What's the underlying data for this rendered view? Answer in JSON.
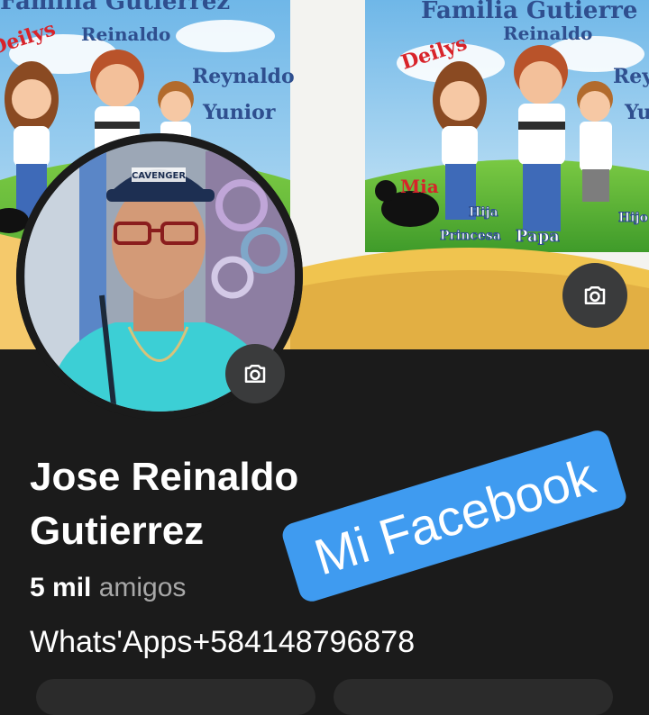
{
  "cover": {
    "title_left": "Familia Gutierrez",
    "title_right": "Familia Gutierre",
    "names": {
      "deilys": "Deilys",
      "reinaldo": "Reinaldo",
      "reynaldo": "Reynaldo",
      "yunior": "Yunior",
      "mia": "Mia",
      "hija": "Hija",
      "princesa": "Princesa",
      "papa": "Papa",
      "hijo": "Hijo"
    },
    "camera_icon": "camera-icon"
  },
  "avatar": {
    "camera_icon": "camera-icon",
    "cap_text": "CAVENGER"
  },
  "profile": {
    "name_line1": "Jose Reinaldo",
    "name_line2": "Gutierrez",
    "friends_count": "5 mil",
    "friends_label": "amigos",
    "bio": "Whats'Apps+584148796878"
  },
  "sticker": {
    "text": "Mi Facebook",
    "color": "#3f9bf0"
  },
  "colors": {
    "background": "#1b1b1b",
    "button": "#3a3b3c"
  }
}
